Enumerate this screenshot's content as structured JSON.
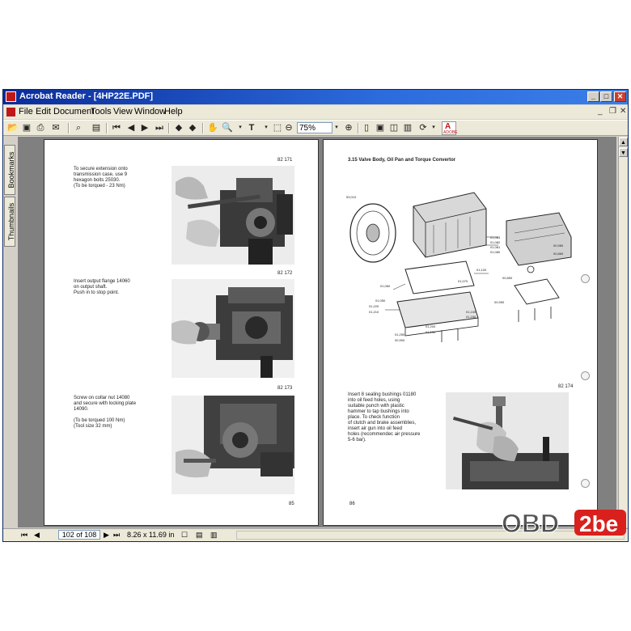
{
  "window": {
    "title": "Acrobat Reader - [4HP22E.PDF]",
    "controls": {
      "minimize": "_",
      "maximize": "□",
      "close": "✕"
    }
  },
  "menu": {
    "items": [
      "File",
      "Edit",
      "Document",
      "Tools",
      "View",
      "Window",
      "Help"
    ]
  },
  "toolbar": {
    "zoom_value": "75%",
    "icons": [
      "open-icon",
      "save-icon",
      "print-icon",
      "email-icon",
      "search-icon",
      "bookmark-pane-icon",
      "first-page-icon",
      "prev-page-icon",
      "next-page-icon",
      "last-page-icon",
      "go-back-icon",
      "go-forward-icon",
      "hand-tool-icon",
      "zoom-tool-icon",
      "text-select-icon",
      "zoom-out-icon",
      "zoom-in-icon",
      "actual-size-icon",
      "fit-page-icon",
      "fit-width-icon",
      "rotate-icon",
      "adobe-icon"
    ],
    "adobe_label": "ADOBE"
  },
  "sidebar": {
    "tabs": [
      "Bookmarks",
      "Thumbnails"
    ]
  },
  "left_page": {
    "sections": [
      {
        "fig": "82 171",
        "text": "To secure extension onto\ntransmission case, use 9\nhexagon bolts 25030.\n(To be torqued - 23 Nm)"
      },
      {
        "fig": "82 172",
        "text": "Insert output flange 14060\non output shaft.\nPush in to stop point."
      },
      {
        "fig": "82 173",
        "text": "Screw on collar nut 14080\nand secure with locking plate\n14090.\n\n(To be torqued 100 Nm)\n(Tool size 32 mm)"
      }
    ],
    "page_number": "85"
  },
  "right_page": {
    "heading": "3.15 Valve Body, Oil Pan and Torque Convertor",
    "diagram_parts": [
      "53,010",
      "01,083",
      "01,082",
      "01,081",
      "01,080",
      "00,980",
      "00,860",
      "01,100",
      "00,850",
      "01,070",
      "01,060",
      "01,050",
      "01,240",
      "01,230",
      "01,220",
      "01,210",
      "01,200",
      "01,190",
      "01,250",
      "00,900",
      "00,950"
    ],
    "fig": "82 174",
    "text": "Insert 8 sealing bushings 01180\ninto oil feed holes, using\nsuitable punch with plastic\nhammer to tap bushings into\nplace. To check function\nof clutch and brake assemblies,\ninsert air gun into oil feed\nholes (recommendec air pressure\n5-6 bar).",
    "page_number": "86"
  },
  "status": {
    "page_indicator": "102 of 108",
    "page_size": "8.26 x 11.69 in"
  },
  "watermark": {
    "prefix": "OBD",
    "suffix": "2be"
  },
  "colors": {
    "titlebar": "#0a2c9a",
    "chrome": "#d4d0c8",
    "workspace": "#808080",
    "watermark_red": "#d9201c"
  }
}
